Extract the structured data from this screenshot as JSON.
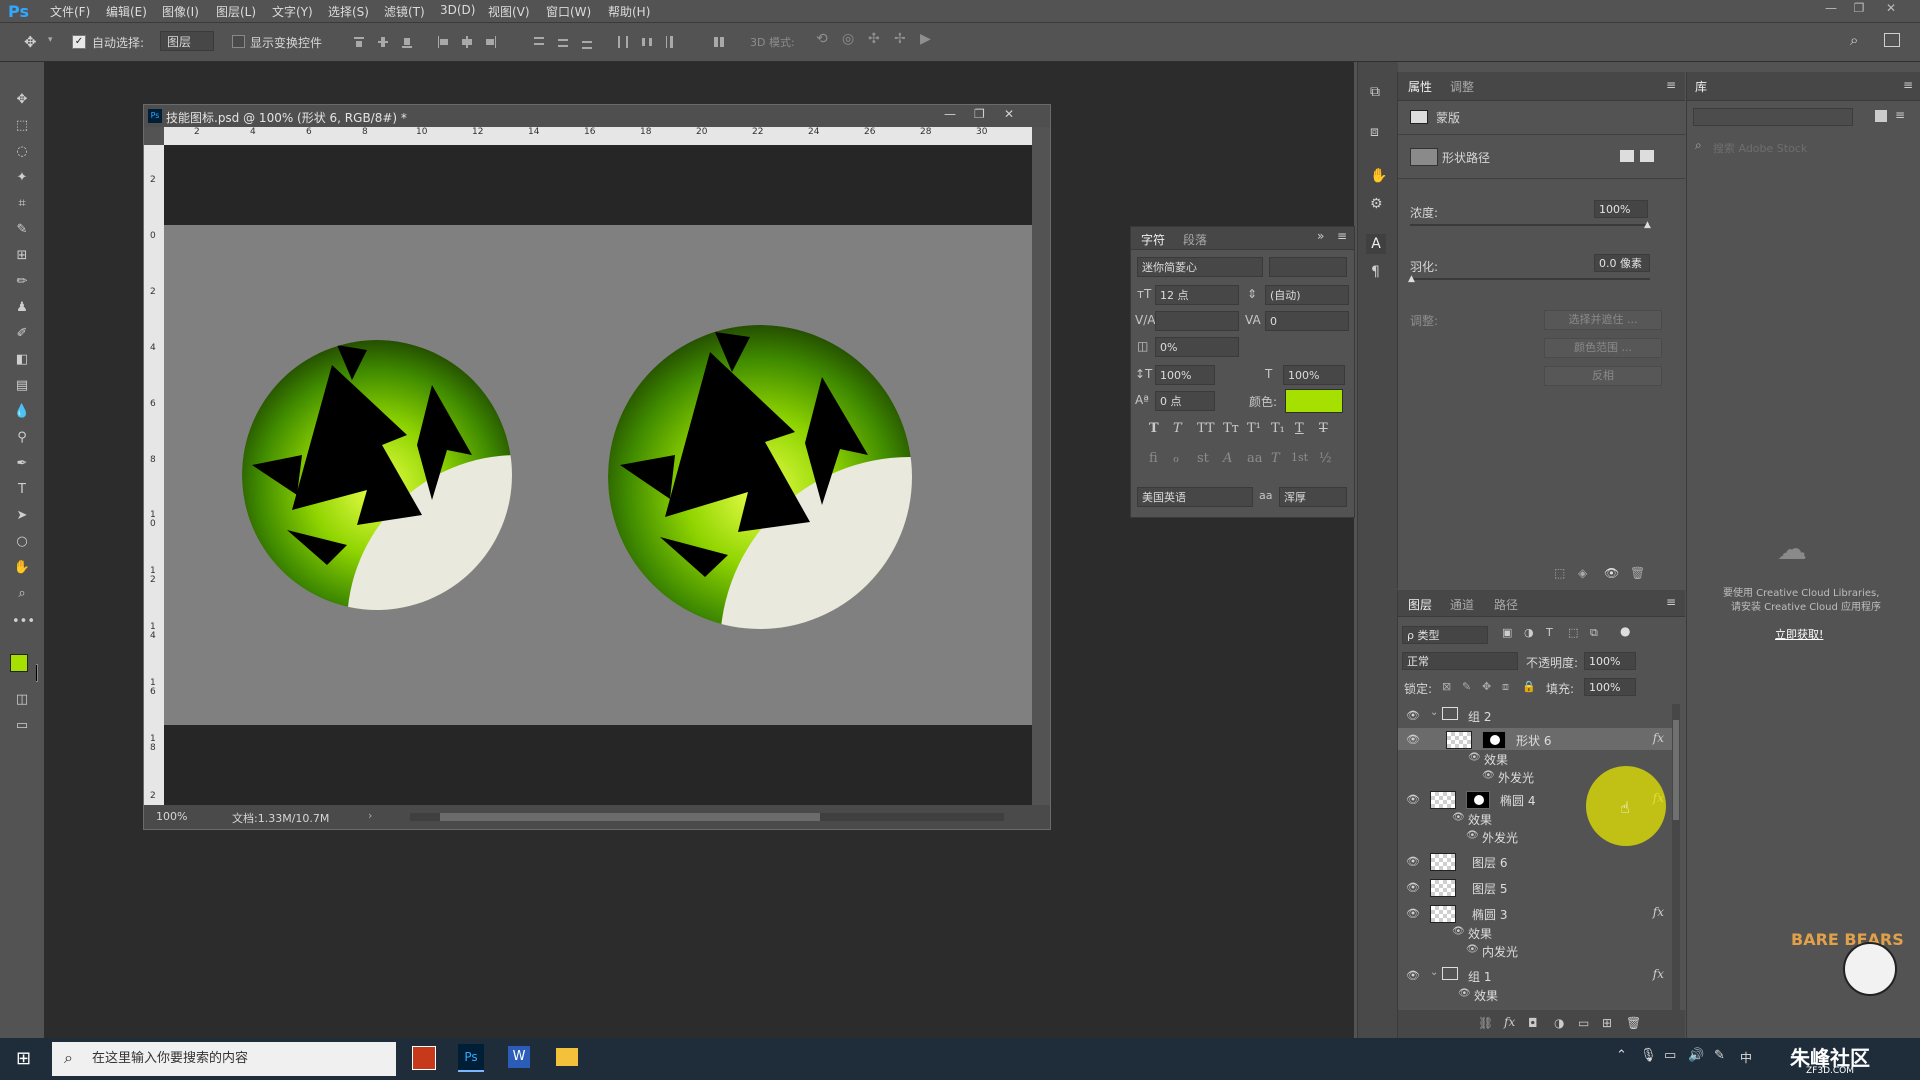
{
  "app": {
    "logo": "Ps"
  },
  "menu": [
    "文件(F)",
    "编辑(E)",
    "图像(I)",
    "图层(L)",
    "文字(Y)",
    "选择(S)",
    "滤镜(T)",
    "3D(D)",
    "视图(V)",
    "窗口(W)",
    "帮助(H)"
  ],
  "window_controls": {
    "minimize": "—",
    "restore": "❐",
    "close": "✕"
  },
  "options_bar": {
    "auto_select_label": "自动选择:",
    "auto_select_checked": true,
    "auto_select_value": "图层",
    "show_transform_label": "显示变换控件",
    "mode_3d_label": "3D 模式:"
  },
  "document": {
    "title": "技能图标.psd @ 100% (形状 6, RGB/8#) *",
    "zoom": "100%",
    "doc_size": "文档:1.33M/10.7M",
    "ruler_top": [
      "2",
      "4",
      "6",
      "8",
      "10",
      "12",
      "14",
      "16",
      "18",
      "20",
      "22",
      "24",
      "26",
      "28",
      "30"
    ],
    "ruler_left": [
      "2",
      "0",
      "2",
      "4",
      "6",
      "8",
      "1\n0",
      "1\n2",
      "1\n4",
      "1\n6",
      "1\n8",
      "2"
    ]
  },
  "character_panel": {
    "tabs": [
      "字符",
      "段落"
    ],
    "font_family": "迷你简菱心",
    "font_size": "12 点",
    "leading": "(自动)",
    "kerning": "",
    "tracking": "0",
    "scale_pct": "0%",
    "vertical_scale": "100%",
    "horizontal_scale": "100%",
    "baseline_shift": "0 点",
    "color_label": "颜色:",
    "color_value": "#a6e000",
    "style_glyphs": [
      "T",
      "T",
      "TT",
      "Tт",
      "T¹",
      "T₁",
      "T",
      "T"
    ],
    "opentype_glyphs": [
      "fi",
      "ℴ",
      "st",
      "A",
      "aa",
      "T",
      "1st",
      "½"
    ],
    "language": "美国英语",
    "antialias_label": "aa",
    "antialias": "浑厚"
  },
  "properties_panel": {
    "tabs": [
      "属性",
      "调整"
    ],
    "section": "蒙版",
    "path_label": "形状路径",
    "density_label": "浓度:",
    "density_value": "100%",
    "feather_label": "羽化:",
    "feather_value": "0.0 像素",
    "adjust_label": "调整:",
    "buttons": [
      "选择并遮住 ...",
      "颜色范围 ...",
      "反相"
    ]
  },
  "library_panel": {
    "tab": "库",
    "search_placeholder": "搜索 Adobe Stock",
    "message_line1": "要使用 Creative Cloud Libraries,",
    "message_line2": "请安装 Creative Cloud 应用程序",
    "link": "立即获取!"
  },
  "layers_panel": {
    "tabs": [
      "图层",
      "通道",
      "路径"
    ],
    "filter_kind": "ρ 类型",
    "blend_mode": "正常",
    "opacity_label": "不透明度:",
    "opacity_value": "100%",
    "lock_label": "锁定:",
    "fill_label": "填充:",
    "fill_value": "100%",
    "rows": [
      {
        "name": "组 2",
        "type": "group"
      },
      {
        "name": "形状 6",
        "type": "shape",
        "fx": "fx"
      },
      {
        "name": "效果",
        "type": "effects"
      },
      {
        "name": "外发光",
        "type": "effect"
      },
      {
        "name": "椭圆 4",
        "type": "shape",
        "fx": "fx"
      },
      {
        "name": "效果",
        "type": "effects"
      },
      {
        "name": "外发光",
        "type": "effect"
      },
      {
        "name": "图层 6",
        "type": "layer"
      },
      {
        "name": "图层 5",
        "type": "layer"
      },
      {
        "name": "椭圆 3",
        "type": "shape",
        "fx": "fx"
      },
      {
        "name": "效果",
        "type": "effects"
      },
      {
        "name": "内发光",
        "type": "effect"
      },
      {
        "name": "组 1",
        "type": "group",
        "fx": "fx"
      },
      {
        "name": "效果",
        "type": "effects"
      }
    ]
  },
  "taskbar": {
    "search_placeholder": "在这里输入你要搜索的内容",
    "apps": [
      "media-player",
      "photoshop",
      "word",
      "file-explorer"
    ],
    "tray_lang": "中",
    "watermark": "朱峰社区",
    "watermark_url": "ZF3D.COM",
    "badge": "BARE BEARS"
  },
  "colors": {
    "foreground": "#a6e000",
    "background": "#000000",
    "accent": "#31a8ff"
  }
}
